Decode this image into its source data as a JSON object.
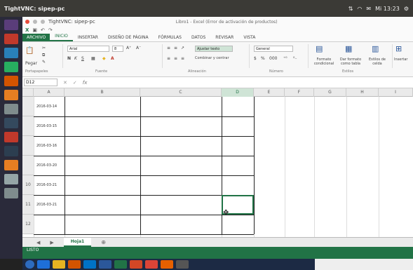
{
  "vnc": {
    "title": "TightVNC: sipep-pc",
    "clock": "Mi 13:23"
  },
  "launcher": [
    {
      "icon": "dash-icon",
      "color": "#5a3d7a"
    },
    {
      "icon": "files-icon",
      "color": "#c0392b"
    },
    {
      "icon": "writer-icon",
      "color": "#2980b9"
    },
    {
      "icon": "calc-icon",
      "color": "#27ae60"
    },
    {
      "icon": "impress-icon",
      "color": "#d35400"
    },
    {
      "icon": "firefox-icon",
      "color": "#e67e22"
    },
    {
      "icon": "settings-icon",
      "color": "#7f8c8d"
    },
    {
      "icon": "terminal-icon",
      "color": "#34495e"
    },
    {
      "icon": "software-icon",
      "color": "#c0392b"
    },
    {
      "icon": "vnc-icon",
      "color": "#2c3e50"
    },
    {
      "icon": "amazon-icon",
      "color": "#e67e22"
    },
    {
      "icon": "disk-icon",
      "color": "#95a5a6"
    },
    {
      "icon": "trash-icon",
      "color": "#7f8c8d"
    }
  ],
  "window": {
    "title": "TightVNC: sipep-pc",
    "document": "Libro1 - Excel (Error de activación de productos)"
  },
  "tabs": [
    "ARCHIVO",
    "INICIO",
    "INSERTAR",
    "DISEÑO DE PÁGINA",
    "FÓRMULAS",
    "DATOS",
    "REVISAR",
    "VISTA"
  ],
  "ribbon": {
    "paste": "Pegar",
    "font_name": "Arial",
    "font_size": "8",
    "wrap_text": "Ajustar texto",
    "merge_center": "Combinar y centrar",
    "number_format": "General",
    "conditional_format": "Formato condicional",
    "format_as_table": "Dar formato como tabla",
    "cell_styles": "Estilos de celda",
    "insert": "Insertar",
    "groups": [
      "Portapapeles",
      "Fuente",
      "Alineación",
      "Número",
      "Estilos"
    ]
  },
  "formula_bar": {
    "name_box": "D12",
    "fx": "fx",
    "value": ""
  },
  "columns": [
    "A",
    "B",
    "C",
    "D",
    "E",
    "F",
    "G",
    "H",
    "I"
  ],
  "selected_column": "D",
  "rows": [
    {
      "num": "",
      "date": "2016-03-14"
    },
    {
      "num": "",
      "date": "2016-03-15"
    },
    {
      "num": "",
      "date": "2016-03-16"
    },
    {
      "num": "",
      "date": "2016-03-20"
    },
    {
      "num": "10",
      "date": "2016-03-21"
    },
    {
      "num": "11",
      "date": "2016-03-21"
    },
    {
      "num": "12",
      "date": ""
    }
  ],
  "sheet": {
    "tab": "Hoja1",
    "add": "⊕"
  },
  "status": {
    "text": "LISTO"
  },
  "taskbar": [
    {
      "icon": "start-icon",
      "color": "#2d6cc0"
    },
    {
      "icon": "ie-icon",
      "color": "#1e6fd9"
    },
    {
      "icon": "explorer-icon",
      "color": "#e6b422"
    },
    {
      "icon": "media-icon",
      "color": "#d35400"
    },
    {
      "icon": "outlook-icon",
      "color": "#0072c6"
    },
    {
      "icon": "word-icon",
      "color": "#2b579a"
    },
    {
      "icon": "excel-icon",
      "color": "#217346"
    },
    {
      "icon": "powerpoint-icon",
      "color": "#d24726"
    },
    {
      "icon": "chrome-icon",
      "color": "#db4437"
    },
    {
      "icon": "firefox-icon",
      "color": "#e66000"
    },
    {
      "icon": "vnc-icon",
      "color": "#555555"
    }
  ]
}
